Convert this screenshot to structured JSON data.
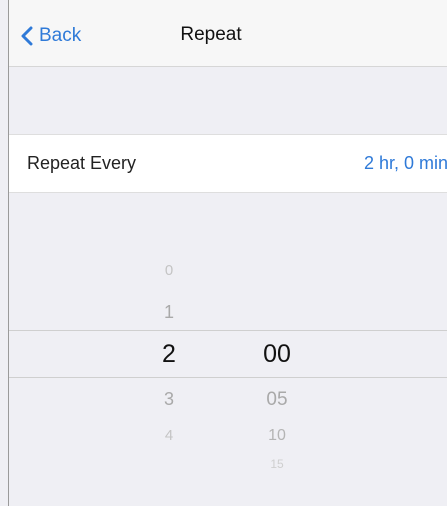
{
  "nav": {
    "back_label": "Back",
    "title": "Repeat"
  },
  "repeat_row": {
    "label": "Repeat Every",
    "value": "2 hr, 0 min"
  },
  "picker": {
    "hours": [
      "0",
      "1",
      "2",
      "3",
      "4"
    ],
    "minutes": [
      "00",
      "05",
      "10",
      "15"
    ],
    "selected_hours": "2",
    "selected_minutes": "00"
  },
  "colors": {
    "accent": "#2f7ad8",
    "background": "#efeff4"
  }
}
